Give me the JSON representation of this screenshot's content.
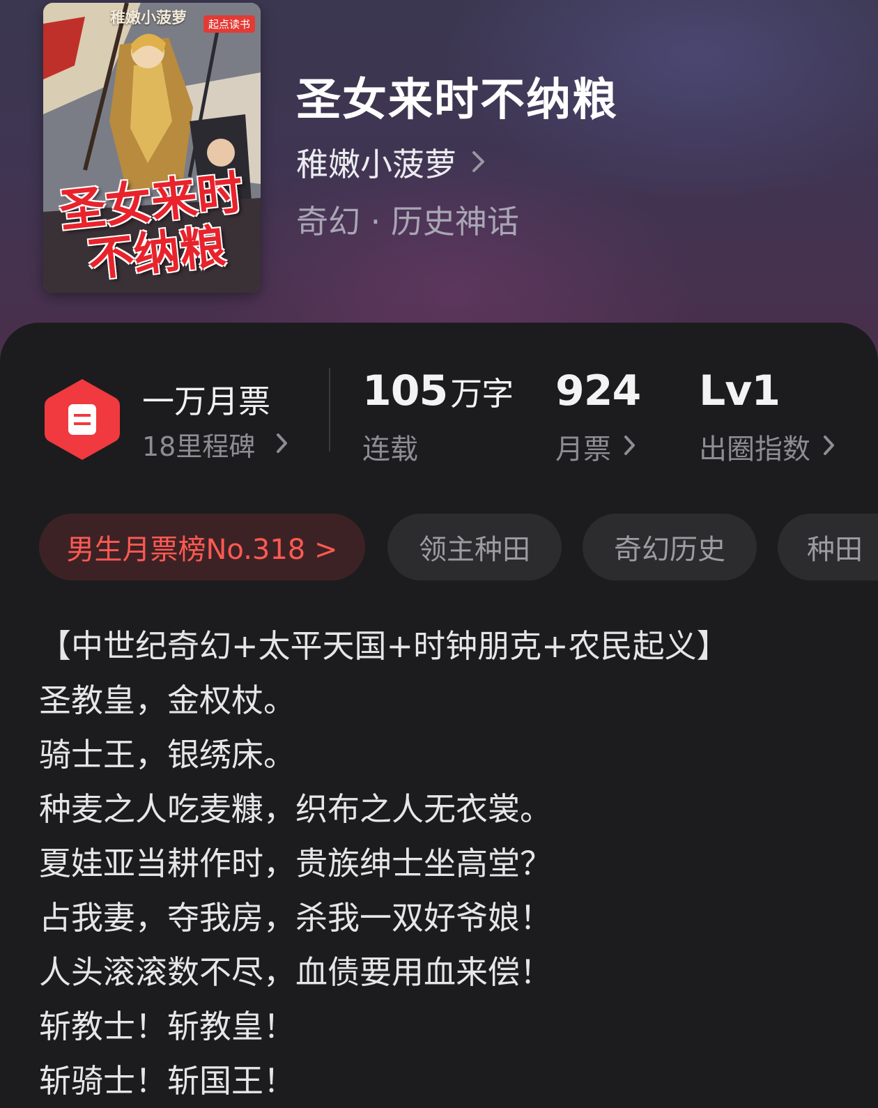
{
  "book": {
    "title": "圣女来时不纳粮",
    "author": "稚嫩小菠萝",
    "genre": "奇幻 · 历史神话",
    "cover": {
      "author_text": "稚嫩小菠萝",
      "brand_text": "起点读书",
      "title_line1": "圣女来时",
      "title_line2": "不纳粮"
    }
  },
  "stats": {
    "milestone": {
      "title": "一万月票",
      "subtitle": "18里程碑"
    },
    "words": {
      "value": "105",
      "unit": "万字",
      "label": "连载"
    },
    "monthly_votes": {
      "value": "924",
      "label": "月票"
    },
    "influence": {
      "value": "Lv1",
      "label": "出圈指数"
    }
  },
  "tags": [
    {
      "label": "男生月票榜No.318 >"
    },
    {
      "label": "领主种田"
    },
    {
      "label": "奇幻历史"
    },
    {
      "label": "种田"
    }
  ],
  "description": [
    "【中世纪奇幻+太平天国+时钟朋克+农民起义】",
    "圣教皇，金权杖。",
    "骑士王，银绣床。",
    "种麦之人吃麦糠，织布之人无衣裳。",
    "夏娃亚当耕作时，贵族绅士坐高堂？",
    "占我妻，夺我房，杀我一双好爷娘！",
    "人头滚滚数不尽，血债要用血来偿！",
    "斩教士！斩教皇！",
    "斩骑士！斩国王！"
  ],
  "colors": {
    "panel_bg": "#1c1c1e",
    "accent_red": "#ff5a52",
    "badge_red": "#f03a3f"
  },
  "icons": {
    "milestone": "ticket-badge-icon",
    "chevron": "chevron-right-icon"
  }
}
